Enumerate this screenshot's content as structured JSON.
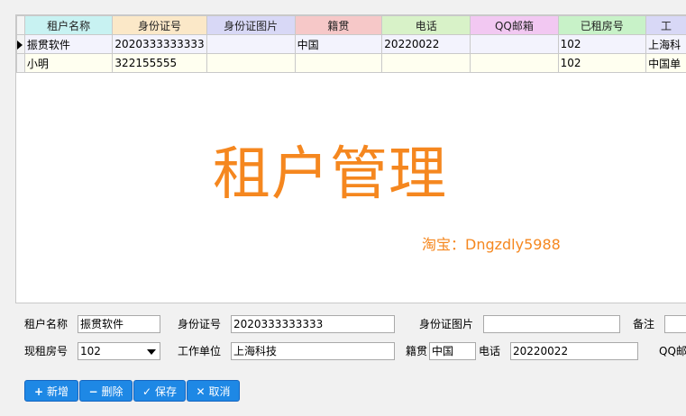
{
  "grid": {
    "columns": [
      {
        "label": "租户名称",
        "color": "#c8f2f2",
        "width": 98
      },
      {
        "label": "身份证号",
        "color": "#fbe8c8",
        "width": 98
      },
      {
        "label": "身份证图片",
        "color": "#d8d8f6",
        "width": 98
      },
      {
        "label": "籍贯",
        "color": "#f6c8c8",
        "width": 98
      },
      {
        "label": "电话",
        "color": "#d8f2c8",
        "width": 98
      },
      {
        "label": "QQ邮箱",
        "color": "#f2c8f2",
        "width": 98
      },
      {
        "label": "已租房号",
        "color": "#c8f2c8",
        "width": 98
      },
      {
        "label": "工",
        "color": "#d8d8f6",
        "width": 40
      }
    ],
    "rows": [
      [
        "振贯软件",
        "2020333333333",
        "",
        "中国",
        "20220022",
        "",
        "102",
        "上海科"
      ],
      [
        "小明",
        "322155555",
        "",
        "",
        "",
        "",
        "102",
        "中国单"
      ]
    ]
  },
  "watermark": {
    "title": "租户管理",
    "subtitle": "淘宝：Dngzdly5988"
  },
  "form": {
    "tenant_name": {
      "label": "租户名称",
      "value": "振贯软件"
    },
    "id_number": {
      "label": "身份证号",
      "value": "2020333333333"
    },
    "id_image": {
      "label": "身份证图片",
      "value": ""
    },
    "remark": {
      "label": "备注",
      "value": ""
    },
    "room": {
      "label": "现租房号",
      "value": "102"
    },
    "work_unit": {
      "label": "工作单位",
      "value": "上海科技"
    },
    "hometown": {
      "label": "籍贯",
      "value": "中国"
    },
    "phone": {
      "label": "电话",
      "value": "20220022"
    },
    "qq": {
      "label": "QQ邮"
    }
  },
  "buttons": {
    "add": "新增",
    "delete": "删除",
    "save": "保存",
    "cancel": "取消"
  }
}
